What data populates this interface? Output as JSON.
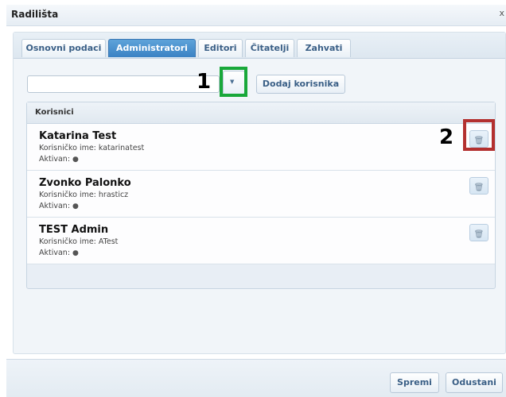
{
  "dialog": {
    "title": "Radilišta",
    "close": "x"
  },
  "tabs": [
    {
      "label": "Osnovni podaci",
      "active": false
    },
    {
      "label": "Administratori",
      "active": true
    },
    {
      "label": "Editori",
      "active": false
    },
    {
      "label": "Čitatelji",
      "active": false
    },
    {
      "label": "Zahvati",
      "active": false
    }
  ],
  "toolbar": {
    "user_select_value": "",
    "dropdown_icon": "chevron-down-icon",
    "add_user_label": "Dodaj korisnika"
  },
  "annotations": {
    "marker1": "1",
    "marker2": "2",
    "marker1_color": "#19a83a",
    "marker2_color": "#b3302f"
  },
  "grid": {
    "header": "Korisnici",
    "rows": [
      {
        "name": "Katarina Test",
        "username": "Korisničko ime: katarinatest",
        "active": "Aktivan:",
        "active_icon": "check-circle-icon",
        "delete_icon": "trash-icon"
      },
      {
        "name": "Zvonko Palonko",
        "username": "Korisničko ime: hrasticz",
        "active": "Aktivan:",
        "active_icon": "check-circle-icon",
        "delete_icon": "trash-icon"
      },
      {
        "name": "TEST Admin",
        "username": "Korisničko ime: ATest",
        "active": "Aktivan:",
        "active_icon": "check-circle-icon",
        "delete_icon": "trash-icon"
      }
    ]
  },
  "footer": {
    "save_label": "Spremi",
    "cancel_label": "Odustani"
  },
  "colors": {
    "accent": "#3b82c4",
    "panel": "#f1f5f9"
  }
}
